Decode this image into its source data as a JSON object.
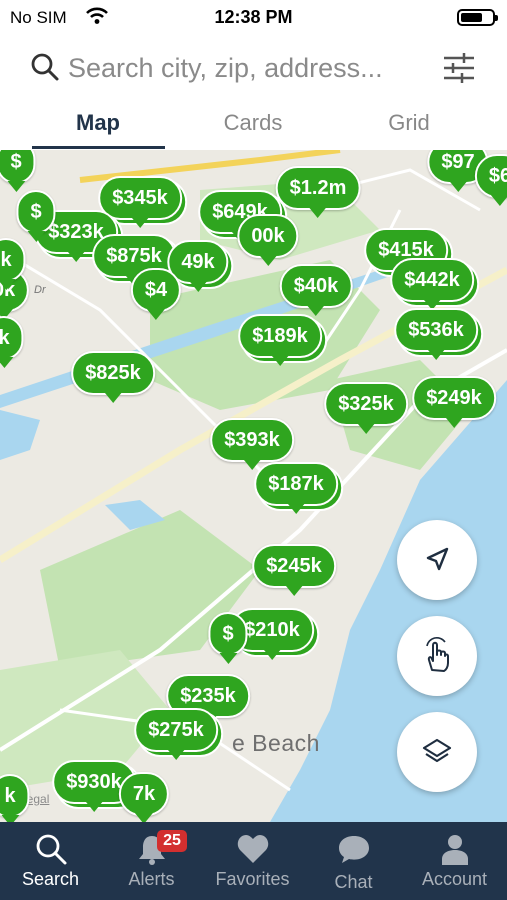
{
  "status": {
    "carrier": "No SIM",
    "time": "12:38 PM",
    "battery_level": 0.65
  },
  "search": {
    "placeholder": "Search city, zip, address..."
  },
  "tabs": [
    {
      "label": "Map"
    },
    {
      "label": "Cards"
    },
    {
      "label": "Grid"
    }
  ],
  "map": {
    "place_label": "e Beach",
    "road_label": "Dr",
    "legal": "Legal",
    "pins": [
      {
        "label": "$97"
      },
      {
        "label": "$6"
      },
      {
        "label": "$345k"
      },
      {
        "label": "$1.2m"
      },
      {
        "label": "$649k"
      },
      {
        "label": "$323k"
      },
      {
        "label": "00k"
      },
      {
        "label": "$875k"
      },
      {
        "label": "49k"
      },
      {
        "label": "$4"
      },
      {
        "label": "$415k"
      },
      {
        "label": "$442k"
      },
      {
        "label": "$40k"
      },
      {
        "label": "$536k"
      },
      {
        "label": "$189k"
      },
      {
        "label": "$825k"
      },
      {
        "label": "$325k"
      },
      {
        "label": "$249k"
      },
      {
        "label": "$393k"
      },
      {
        "label": "$187k"
      },
      {
        "label": "$245k"
      },
      {
        "label": "$210k"
      },
      {
        "label": "$"
      },
      {
        "label": "$235k"
      },
      {
        "label": "$275k"
      },
      {
        "label": "$930k"
      },
      {
        "label": "7k"
      },
      {
        "label": "k"
      },
      {
        "label": "0k"
      },
      {
        "label": "k"
      },
      {
        "label": "$"
      },
      {
        "label": "$"
      },
      {
        "label": "k"
      }
    ]
  },
  "map_controls": [
    {
      "icon": "location-arrow-icon"
    },
    {
      "icon": "hand-draw-icon"
    },
    {
      "icon": "layers-icon"
    }
  ],
  "tabbar": {
    "items": [
      {
        "label": "Search",
        "icon": "search-icon"
      },
      {
        "label": "Alerts",
        "icon": "bell-icon",
        "badge": "25"
      },
      {
        "label": "Favorites",
        "icon": "heart-icon"
      },
      {
        "label": "Chat",
        "icon": "chat-icon"
      },
      {
        "label": "Account",
        "icon": "account-icon"
      }
    ]
  },
  "colors": {
    "pin": "#2fa51f",
    "tabbar": "#21344b",
    "water": "#a9d6ef",
    "park": "#c3e3b2",
    "badge": "#d32f2f"
  }
}
